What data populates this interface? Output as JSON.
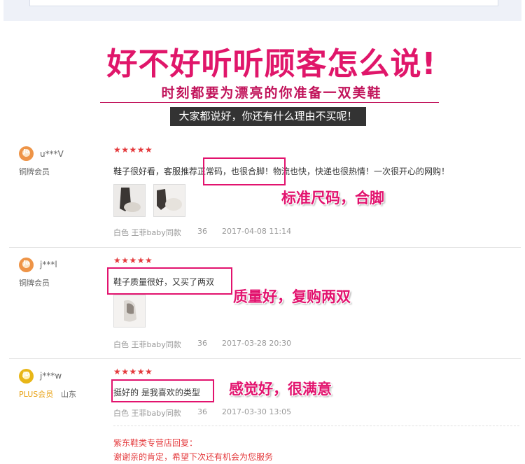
{
  "banner": {
    "headline": "好不好听听顾客怎么说!",
    "subline": "时刻都要为漂亮的你准备一双美鞋",
    "tagline": "大家都说好，你还有什么理由不买呢！"
  },
  "reviews": [
    {
      "username": "u***V",
      "level": "铜牌会员",
      "stars": "★★★★★",
      "text": "鞋子很好看，客服推荐正常码，也很合脚！物流也快，快递也很热情！一次很开心的网购！",
      "callout": "标准尺码，合脚",
      "color": "白色 王菲baby同款",
      "size": "36",
      "date": "2017-04-08 11:14"
    },
    {
      "username": "j***l",
      "level": "铜牌会员",
      "stars": "★★★★★",
      "text": "鞋子质量很好，又买了两双",
      "callout": "质量好，复购两双",
      "color": "白色 王菲baby同款",
      "size": "36",
      "date": "2017-03-28 20:30"
    },
    {
      "username": "j***w",
      "level": "PLUS会员",
      "location": "山东",
      "stars": "★★★★★",
      "text": "挺好的 是我喜欢的类型",
      "callout": "感觉好，很满意",
      "color": "白色 王菲baby同款",
      "size": "36",
      "date": "2017-03-30 13:05",
      "reply_title": "紫东鞋类专营店回复：",
      "reply_body": "谢谢亲的肯定，希望下次还有机会为您服务"
    }
  ],
  "colors": {
    "accent": "#e2136e",
    "star": "#e4393c",
    "plus": "#e8a317"
  }
}
